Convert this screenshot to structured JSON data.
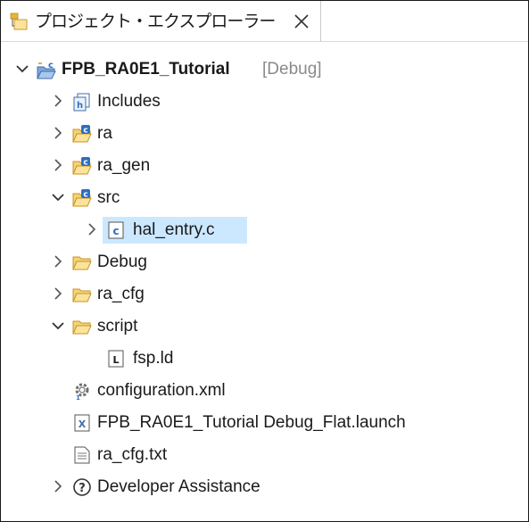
{
  "tab": {
    "title": "プロジェクト・エクスプローラー",
    "close_glyph": "×"
  },
  "tree": {
    "project": {
      "name": "FPB_RA0E1_Tutorial",
      "decoration": "[Debug]"
    },
    "includes": "Includes",
    "ra": "ra",
    "ra_gen": "ra_gen",
    "src": "src",
    "hal_entry": "hal_entry.c",
    "debug": "Debug",
    "ra_cfg": "ra_cfg",
    "script": "script",
    "fsp_ld": "fsp.ld",
    "configuration": "configuration.xml",
    "launch": "FPB_RA0E1_Tutorial Debug_Flat.launch",
    "ra_cfg_txt": "ra_cfg.txt",
    "developer_assistance": "Developer Assistance"
  },
  "icons": {
    "project_explorer": "project-explorer-icon",
    "project": "c-project-icon",
    "includes": "includes-icon",
    "source_folder": "source-folder-icon",
    "folder": "folder-icon",
    "c_file": "c-file-icon",
    "linker_file": "linker-script-icon",
    "config": "gear-icon",
    "launch": "launch-config-icon",
    "text_file": "text-file-icon",
    "help": "help-icon"
  },
  "colors": {
    "selection": "#cce8ff",
    "folder_yellow": "#e8b730",
    "source_blue": "#2f6fc0",
    "decoration_gray": "#8a8a8a"
  }
}
